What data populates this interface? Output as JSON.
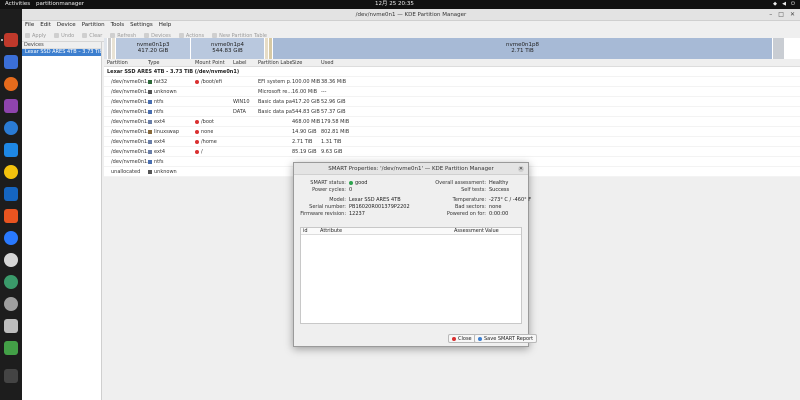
{
  "topbar": {
    "activities": "Activities",
    "app_name": "partitionmanager",
    "clock": "12月 25  20:35"
  },
  "window": {
    "title": "/dev/nvme0n1 — KDE Partition Manager"
  },
  "menu": [
    "File",
    "Edit",
    "Device",
    "Partition",
    "Tools",
    "Settings",
    "Help"
  ],
  "toolbar": [
    "Apply",
    "Undo",
    "Clear",
    "Refresh",
    "Devices",
    "Actions",
    "New Partition Table"
  ],
  "devices_pane": {
    "header": "Devices",
    "selected_device": "Lexar SSD ARES 4TB – 3.73 TiB"
  },
  "graphic": {
    "segments": [
      {
        "name": "nvme0n1p3",
        "size": "417.20 GiB",
        "color": "#b9c8de"
      },
      {
        "name": "nvme0n1p4",
        "size": "544.83 GiB",
        "color": "#b9c8de"
      },
      {
        "name": "nvme0n1p8",
        "size": "2.71 TiB",
        "color": "#a7bad6"
      }
    ]
  },
  "table": {
    "headers": [
      "Partition",
      "Type",
      "Mount Point",
      "Label",
      "Partition Label",
      "Size",
      "Used"
    ],
    "drive": "Lexar SSD ARES 4TB - 3.73 TiB (/dev/nvme0n1)",
    "rows": [
      {
        "partition": "/dev/nvme0n1...",
        "type": "fat32",
        "type_color": "#2f6a3a",
        "mount": "/boot/efi",
        "locked": true,
        "label": "",
        "plabel": "EFI system p...",
        "size": "100.00 MiB",
        "used": "38.36 MiB"
      },
      {
        "partition": "/dev/nvme0n1...",
        "type": "unknown",
        "type_color": "#555555",
        "mount": "",
        "locked": false,
        "label": "",
        "plabel": "Microsoft re...",
        "size": "16.00 MiB",
        "used": "---"
      },
      {
        "partition": "/dev/nvme0n1...",
        "type": "ntfs",
        "type_color": "#4a6fb0",
        "mount": "",
        "locked": false,
        "label": "WIN10",
        "plabel": "Basic data pa...",
        "size": "417.20 GiB",
        "used": "52.96 GiB"
      },
      {
        "partition": "/dev/nvme0n1...",
        "type": "ntfs",
        "type_color": "#4a6fb0",
        "mount": "",
        "locked": false,
        "label": "DATA",
        "plabel": "Basic data pa...",
        "size": "544.83 GiB",
        "used": "57.37 GiB"
      },
      {
        "partition": "/dev/nvme0n1...",
        "type": "ext4",
        "type_color": "#6b7fa8",
        "mount": "/boot",
        "locked": true,
        "label": "",
        "plabel": "",
        "size": "468.00 MiB",
        "used": "179.58 MiB"
      },
      {
        "partition": "/dev/nvme0n1...",
        "type": "linuxswap",
        "type_color": "#8a6a3a",
        "mount": "none",
        "locked": true,
        "label": "",
        "plabel": "",
        "size": "14.90 GiB",
        "used": "802.81 MiB"
      },
      {
        "partition": "/dev/nvme0n1...",
        "type": "ext4",
        "type_color": "#6b7fa8",
        "mount": "/home",
        "locked": true,
        "label": "",
        "plabel": "",
        "size": "2.71 TiB",
        "used": "1.31 TiB"
      },
      {
        "partition": "/dev/nvme0n1...",
        "type": "ext4",
        "type_color": "#6b7fa8",
        "mount": "/",
        "locked": true,
        "label": "",
        "plabel": "",
        "size": "85.19 GiB",
        "used": "9.63 GiB"
      },
      {
        "partition": "/dev/nvme0n1...",
        "type": "ntfs",
        "type_color": "#4a6fb0",
        "mount": "",
        "locked": false,
        "label": "",
        "plabel": "",
        "size": "",
        "used": ""
      },
      {
        "partition": "unallocated",
        "type": "unknown",
        "type_color": "#555555",
        "mount": "",
        "locked": false,
        "label": "",
        "plabel": "",
        "size": "",
        "used": ""
      }
    ]
  },
  "dialog": {
    "title": "SMART Properties: '/dev/nvme0n1' — KDE Partition Manager",
    "smart_status_label": "SMART status:",
    "smart_status_value": "good",
    "power_cycles_label": "Power cycles:",
    "power_cycles_value": "0",
    "model_label": "Model:",
    "model_value": "Lexar SSD ARES 4TB",
    "serial_label": "Serial number:",
    "serial_value": "PB16020R001379P2202",
    "firmware_label": "Firmware revision:",
    "firmware_value": "12237",
    "overall_label": "Overall assessment:",
    "overall_value": "Healthy",
    "selftests_label": "Self tests:",
    "selftests_value": "Success",
    "temperature_label": "Temperature:",
    "temperature_value": "-273° C / -460° F",
    "badsectors_label": "Bad sectors:",
    "badsectors_value": "none",
    "powered_on_label": "Powered on for:",
    "powered_on_value": "0:00:00",
    "columns": {
      "id": "id",
      "attribute": "Attribute",
      "assessment": "Assessment",
      "value": "Value"
    },
    "close_button": "Close",
    "save_button": "Save SMART Report"
  }
}
